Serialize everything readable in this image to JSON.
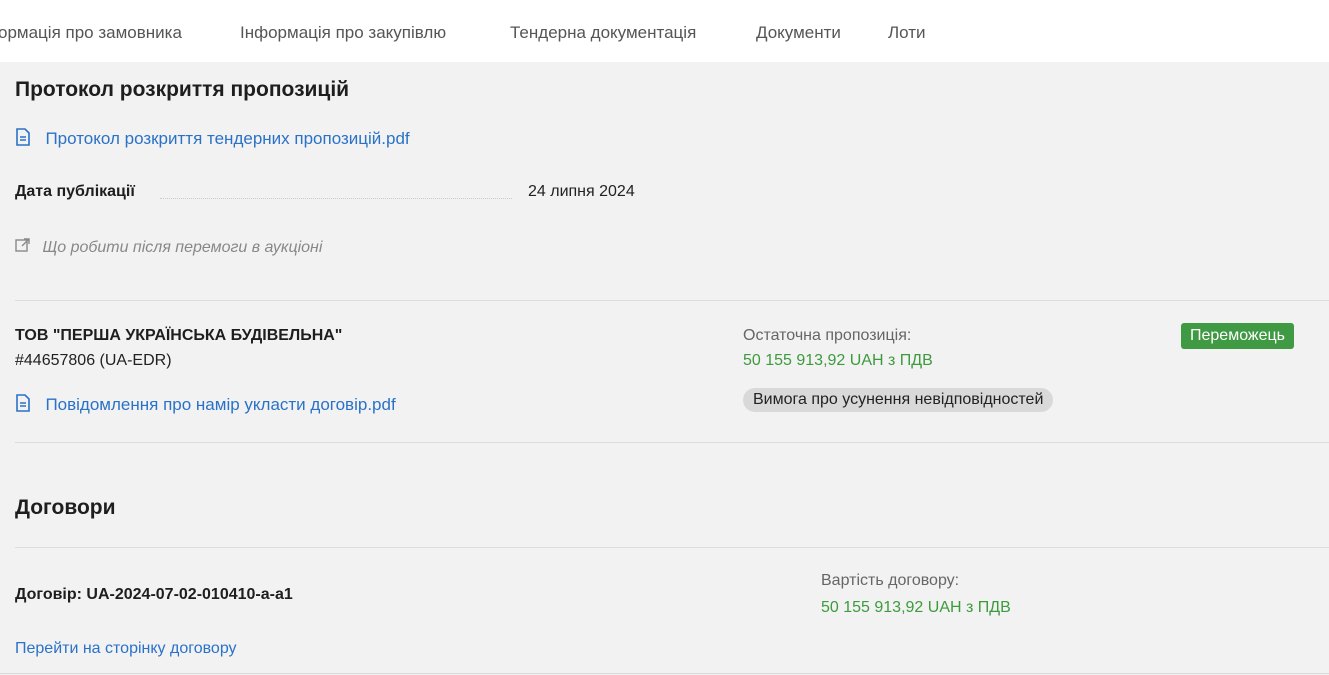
{
  "nav": {
    "tabs": [
      {
        "label": "ормація про замовника"
      },
      {
        "label": "Інформація про закупівлю"
      },
      {
        "label": "Тендерна документація"
      },
      {
        "label": "Документи"
      },
      {
        "label": "Лоти"
      }
    ]
  },
  "protocol": {
    "title": "Протокол розкриття пропозицій",
    "file_link": "Протокол розкриття тендерних пропозицій.pdf",
    "pub_label": "Дата публікації",
    "pub_date": "24 липня 2024",
    "after_win_link": "Що робити після перемоги в аукціоні"
  },
  "bidder": {
    "name": "ТОВ \"ПЕРША УКРАЇНСЬКА БУДІВЕЛЬНА\"",
    "id": "#44657806 (UA-EDR)",
    "notice_link": "Повідомлення про намір укласти договір.pdf",
    "final_offer_label": "Остаточна пропозиція:",
    "final_offer_value": "50 155 913,92 UAH з ПДВ",
    "requirement_badge": "Вимога про усунення невідповідностей",
    "winner_badge": "Переможець"
  },
  "contracts": {
    "title": "Договори",
    "contract_label": "Договір: UA-2024-07-02-010410-a-a1",
    "value_label": "Вартість договору:",
    "value": "50 155 913,92 UAH з ПДВ",
    "go_link": "Перейти на сторінку договору"
  },
  "colors": {
    "link": "#2a72c8",
    "green": "#3d9a3d",
    "winner_bg": "#3f9a43",
    "panel_bg": "#f2f2f2"
  },
  "icons": {
    "file": "document-icon",
    "external": "external-link-icon"
  }
}
